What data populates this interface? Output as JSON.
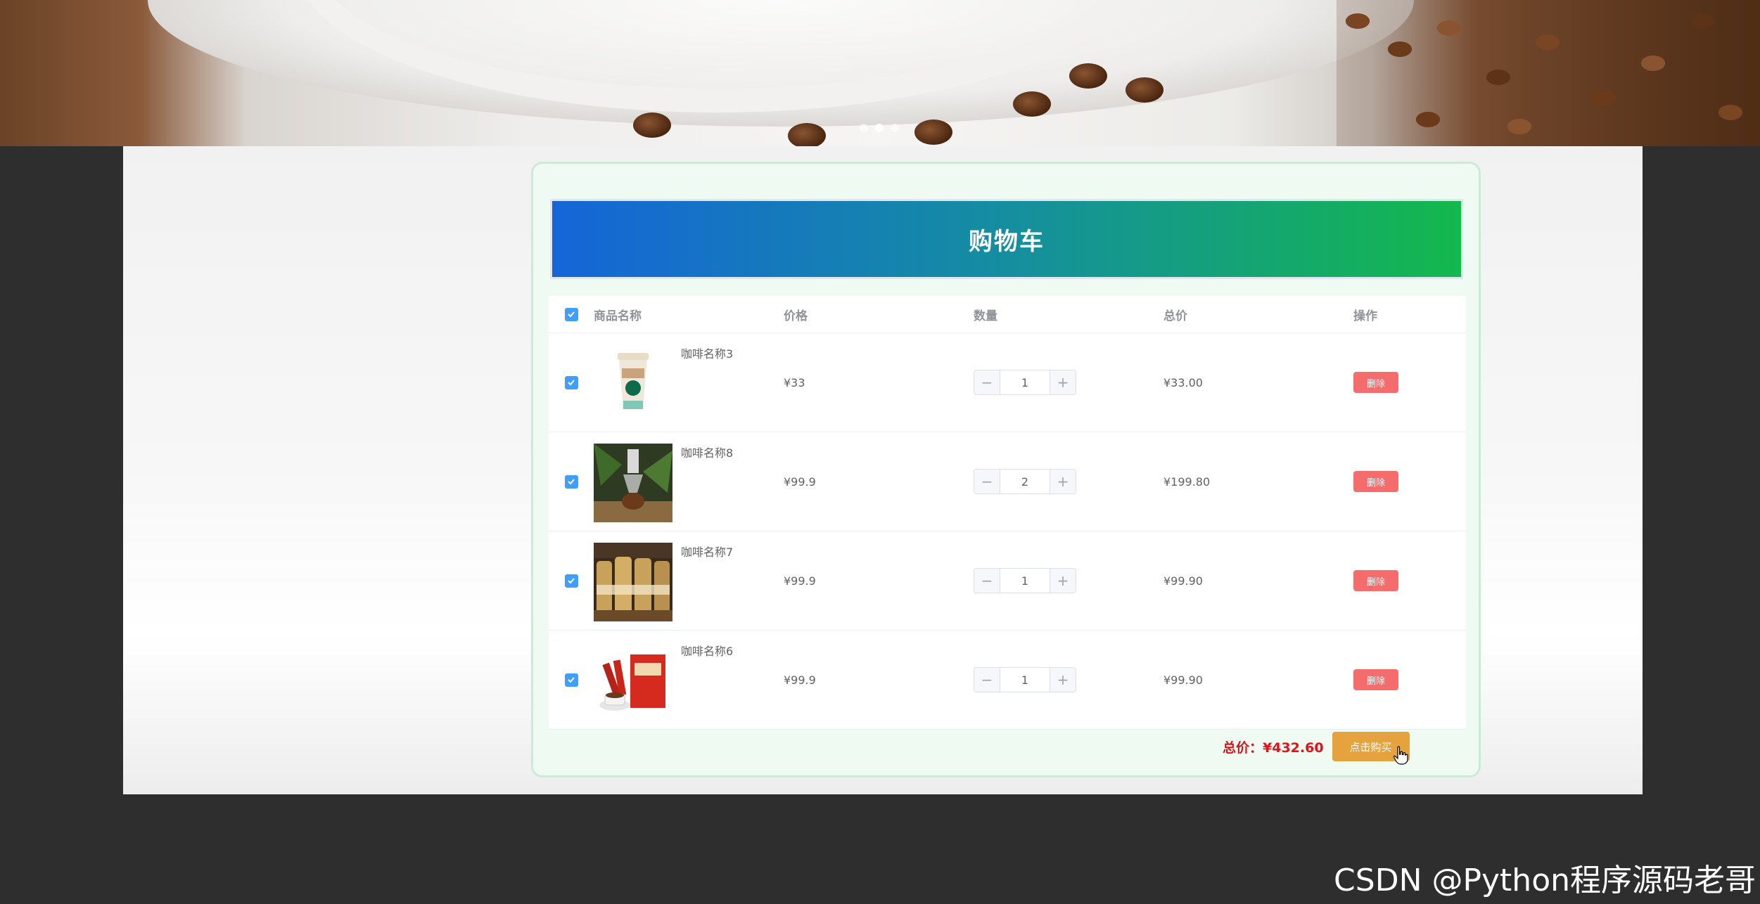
{
  "banner": {
    "slides": 3,
    "active_slide": 2
  },
  "cart": {
    "title": "购物车",
    "columns": {
      "name": "商品名称",
      "price": "价格",
      "qty": "数量",
      "total": "总价",
      "op": "操作"
    },
    "items": [
      {
        "name": "咖啡名称3",
        "price": "¥33",
        "qty": "1",
        "total": "¥33.00",
        "delete": "删除",
        "image": "coffee-cup"
      },
      {
        "name": "咖啡名称8",
        "price": "¥99.9",
        "qty": "2",
        "total": "¥199.80",
        "delete": "删除",
        "image": "coffee-machine"
      },
      {
        "name": "咖啡名称7",
        "price": "¥99.9",
        "qty": "1",
        "total": "¥99.90",
        "delete": "删除",
        "image": "coffee-bottles"
      },
      {
        "name": "咖啡名称6",
        "price": "¥99.9",
        "qty": "1",
        "total": "¥99.90",
        "delete": "删除",
        "image": "coffee-box"
      }
    ],
    "total_label": "总价：¥432.60",
    "buy_label": "点击购买"
  },
  "colors": {
    "checkbox": "#409eff",
    "delete": "#f56c6c",
    "buy": "#e6a23c",
    "total": "#e0131a"
  },
  "watermark": "CSDN @Python程序源码老哥"
}
